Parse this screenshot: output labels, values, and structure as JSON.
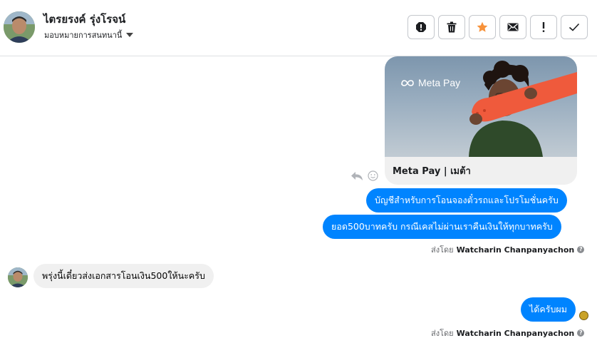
{
  "header": {
    "contact_name": "ไตรยรงค์ รุ่งโรจน์",
    "assign_label": "มอบหมายการสนทนานี้",
    "tools": [
      {
        "name": "spam-icon"
      },
      {
        "name": "trash-icon"
      },
      {
        "name": "star-icon",
        "color": "#f7923a"
      },
      {
        "name": "envelope-icon"
      },
      {
        "name": "exclamation-icon"
      },
      {
        "name": "check-icon"
      }
    ]
  },
  "messages": {
    "card": {
      "brand": "Meta Pay",
      "title": "Meta Pay | เมต้า"
    },
    "out1": "บัญชีสำหรับการโอนจองตั๋วรถและโปรโมชั่นครับ",
    "out2": "ยอด500บาทครับ กรณีเคสไม่ผ่านเราคืนเงินให้ทุกบาทครับ",
    "in1": "พรุ่งนี้เดี๋ยวส่งเอกสารโอนเงิน500ให้นะครับ",
    "out3": "ได้ครับผม",
    "sent_by_prefix": "ส่งโดย",
    "sent_by_name": "Watcharin Chanpanyachon",
    "help_glyph": "?"
  },
  "colors": {
    "bubble_out": "#0084ff",
    "bubble_in": "#f0f0f0",
    "accent_star": "#f7923a"
  }
}
